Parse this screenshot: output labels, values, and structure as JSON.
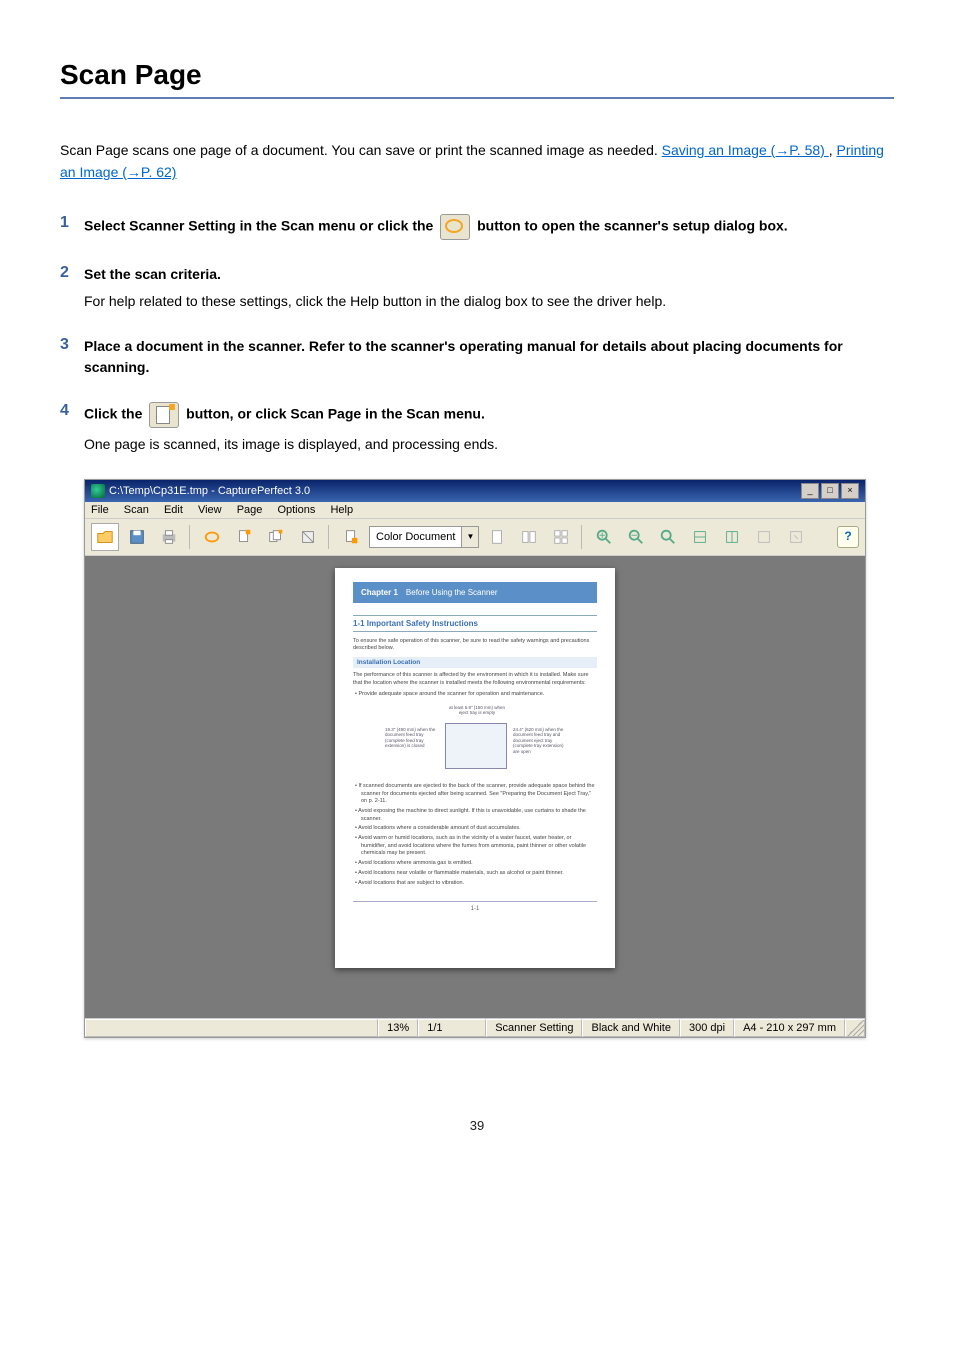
{
  "title": "Scan Page",
  "intro_text": "Scan Page scans one page of a document. You can save or print the scanned image as needed. ",
  "intro_link1": "Saving an Image (→P. 58) ",
  "intro_sep": ",  ",
  "intro_link2": "Printing an Image (→P. 62) ",
  "steps": {
    "s1a": "Select Scanner Setting in the Scan menu or click the ",
    "s1b": " button to open the scanner's setup dialog box.",
    "s2_title": "Set the scan criteria.",
    "s2_body": "For help related to these settings, click the Help button in the dialog box to see the driver help.",
    "s3_title": "Place a document in the scanner. Refer to the scanner's operating manual for details about placing documents for scanning.",
    "s4a": "Click the ",
    "s4b": " button, or click Scan Page in the Scan menu.",
    "s4_body": "One page is scanned, its image is displayed, and processing ends."
  },
  "screenshot": {
    "window_title": "C:\\Temp\\Cp31E.tmp - CapturePerfect 3.0",
    "menu": [
      "File",
      "Scan",
      "Edit",
      "View",
      "Page",
      "Options",
      "Help"
    ],
    "toolbar_dropdown": "Color Document",
    "help_btn": "?",
    "win_controls": [
      "_",
      "□",
      "×"
    ],
    "doc": {
      "chapter_label": "Chapter 1",
      "chapter_title": "Before Using the Scanner",
      "sec_title": "1-1  Important Safety Instructions",
      "para1": "To ensure the safe operation of this scanner, be sure to read the safety warnings and precautions described below.",
      "subhead": "Installation Location",
      "para2": "The performance of this scanner is affected by the environment in which it is installed. Make sure that the location where the scanner is installed meets the following environmental requirements:",
      "b0": "• Provide adequate space around the scanner for operation and maintenance.",
      "diag_top": "at least 5.9\" (150 mm) when eject tray is empty",
      "diag_left": "19.3\" (490 mm) when the document feed tray (complete feed tray extension) is closed",
      "diag_right": "24.4\" (620 mm) when the document feed tray and document eject tray (complete tray extension) are open",
      "b1": "• If scanned documents are ejected to the back of the scanner, provide adequate space behind the scanner for documents ejected after being scanned. See \"Preparing the Document Eject Tray,\" on p. 2-11.",
      "b2": "• Avoid exposing the machine to direct sunlight. If this is unavoidable, use curtains to shade the scanner.",
      "b3": "• Avoid locations where a considerable amount of dust accumulates.",
      "b4": "• Avoid warm or humid locations, such as in the vicinity of a water faucet, water heater, or humidifier, and avoid locations where the fumes from ammonia, paint thinner or other volatile chemicals may be present.",
      "b5": "• Avoid locations where ammonia gas is emitted.",
      "b6": "• Avoid locations near volatile or flammable materials, such as alcohol or paint thinner.",
      "b7": "• Avoid locations that are subject to vibration.",
      "footer": "1-1"
    },
    "status": {
      "zoom": "13%",
      "page": "1/1",
      "setting": "Scanner Setting",
      "mode": "Black and White",
      "dpi": "300 dpi",
      "size": "A4 - 210 x 297 mm"
    }
  },
  "page_number": "39"
}
